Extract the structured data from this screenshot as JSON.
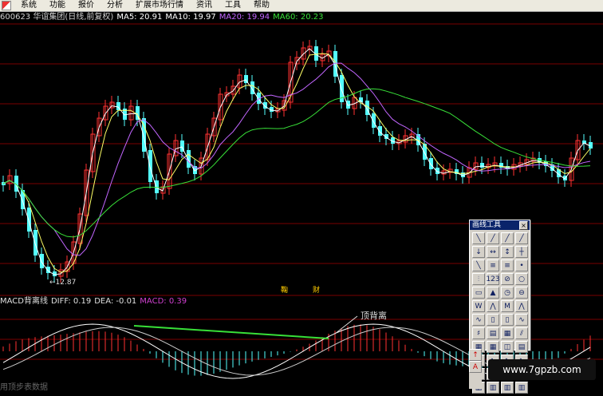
{
  "menu": {
    "items": [
      "系统",
      "功能",
      "报价",
      "分析",
      "扩展市场行情",
      "资讯",
      "工具",
      "帮助"
    ]
  },
  "header": {
    "code_name": "600623 华谊集团(日线,前复权)",
    "ma5": "MA5: 20.91",
    "ma10": "MA10: 19.97",
    "ma20": "MA20: 19.94",
    "ma60": "MA60: 20.23"
  },
  "low_label": "←12.87",
  "markers": [
    "鞠",
    "财",
    "",
    "",
    ""
  ],
  "macd_header": {
    "name": "MACD背离线",
    "diff": "DIFF: 0.19",
    "dea": "DEA: -0.01",
    "macd": "MACD: 0.39"
  },
  "annotation": "顶背离",
  "tool_panel": {
    "title": "画线工具",
    "close": "×",
    "tools": [
      "╲",
      "╱",
      "╱",
      "╱",
      "↓",
      "↔",
      "↕",
      "┼",
      "╲",
      "≡",
      "≡",
      "•",
      "⫶",
      "123",
      "⊘",
      "○",
      "▭",
      "▲",
      "◷",
      "⊖",
      "W",
      "⋀",
      "M",
      "⋀",
      "∿",
      "▯",
      "▯",
      "∿",
      "♯",
      "▤",
      "▦",
      "⫽",
      "▦",
      "▦",
      "◫",
      "▤",
      "∿",
      "∿",
      "∿",
      "∿",
      "▥",
      "▥",
      "▥",
      "▥",
      "▥",
      "▥",
      "▥",
      "▥"
    ],
    "extra": [
      "↑",
      "A"
    ]
  },
  "watermark": "www.7gpzb.com",
  "bottom_text": "用顶步表数据",
  "colors": {
    "candle_up": "#ff3232",
    "candle_down": "#54ffff",
    "ma5": "#ffffff",
    "ma10": "#ffff66",
    "ma20": "#c266ff",
    "ma60": "#38e038",
    "grid": "#7a0000"
  }
}
